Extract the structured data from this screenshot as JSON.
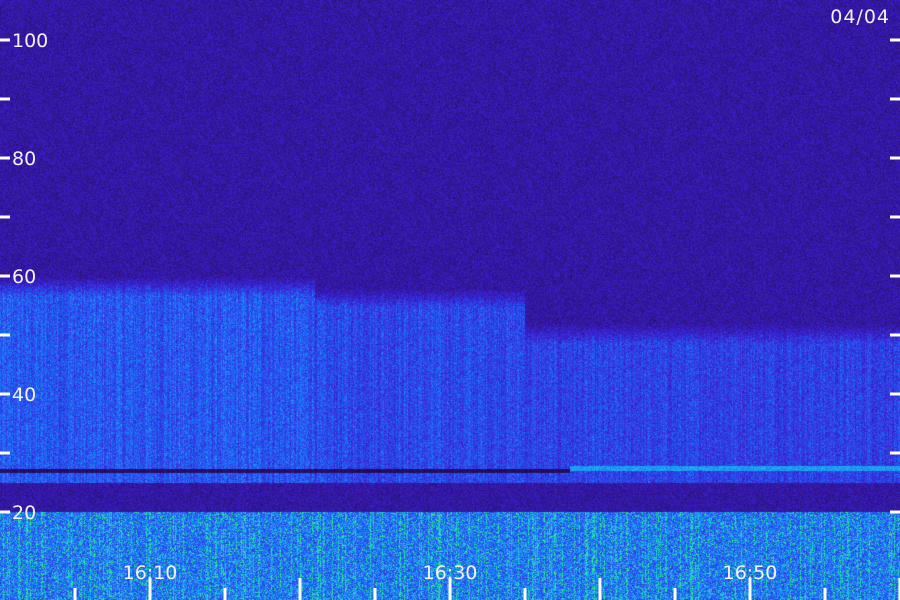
{
  "chart_data": {
    "type": "heatmap",
    "date": "04/04",
    "y_ticks": [
      "100",
      "80",
      "60",
      "40",
      "20"
    ],
    "x_ticks": [
      "16:10",
      "16:30",
      "16:50"
    ],
    "ylim": [
      15,
      105
    ],
    "grid": false,
    "colormap": [
      "#000000",
      "#2a0f6b",
      "#3b1fd0",
      "#1f6cff",
      "#19d3e0",
      "#3cf06a"
    ],
    "bands": [
      {
        "kind": "broadband-noise",
        "y_range": [
          15,
          20
        ],
        "intensity": 1.0
      },
      {
        "kind": "wave-activity",
        "x_range": [
          "16:00",
          "16:21"
        ],
        "y_range": [
          25,
          60
        ],
        "intensity": 0.65
      },
      {
        "kind": "wave-activity",
        "x_range": [
          "16:21",
          "16:35"
        ],
        "y_range": [
          25,
          58
        ],
        "intensity": 0.55
      },
      {
        "kind": "wave-activity",
        "x_range": [
          "16:35",
          "17:00"
        ],
        "y_range": [
          25,
          52
        ],
        "intensity": 0.5
      },
      {
        "kind": "dark-line",
        "y": 27
      },
      {
        "kind": "emission-line",
        "x_range": [
          "16:38",
          "17:00"
        ],
        "y": 27.5,
        "intensity": 0.8
      }
    ]
  }
}
